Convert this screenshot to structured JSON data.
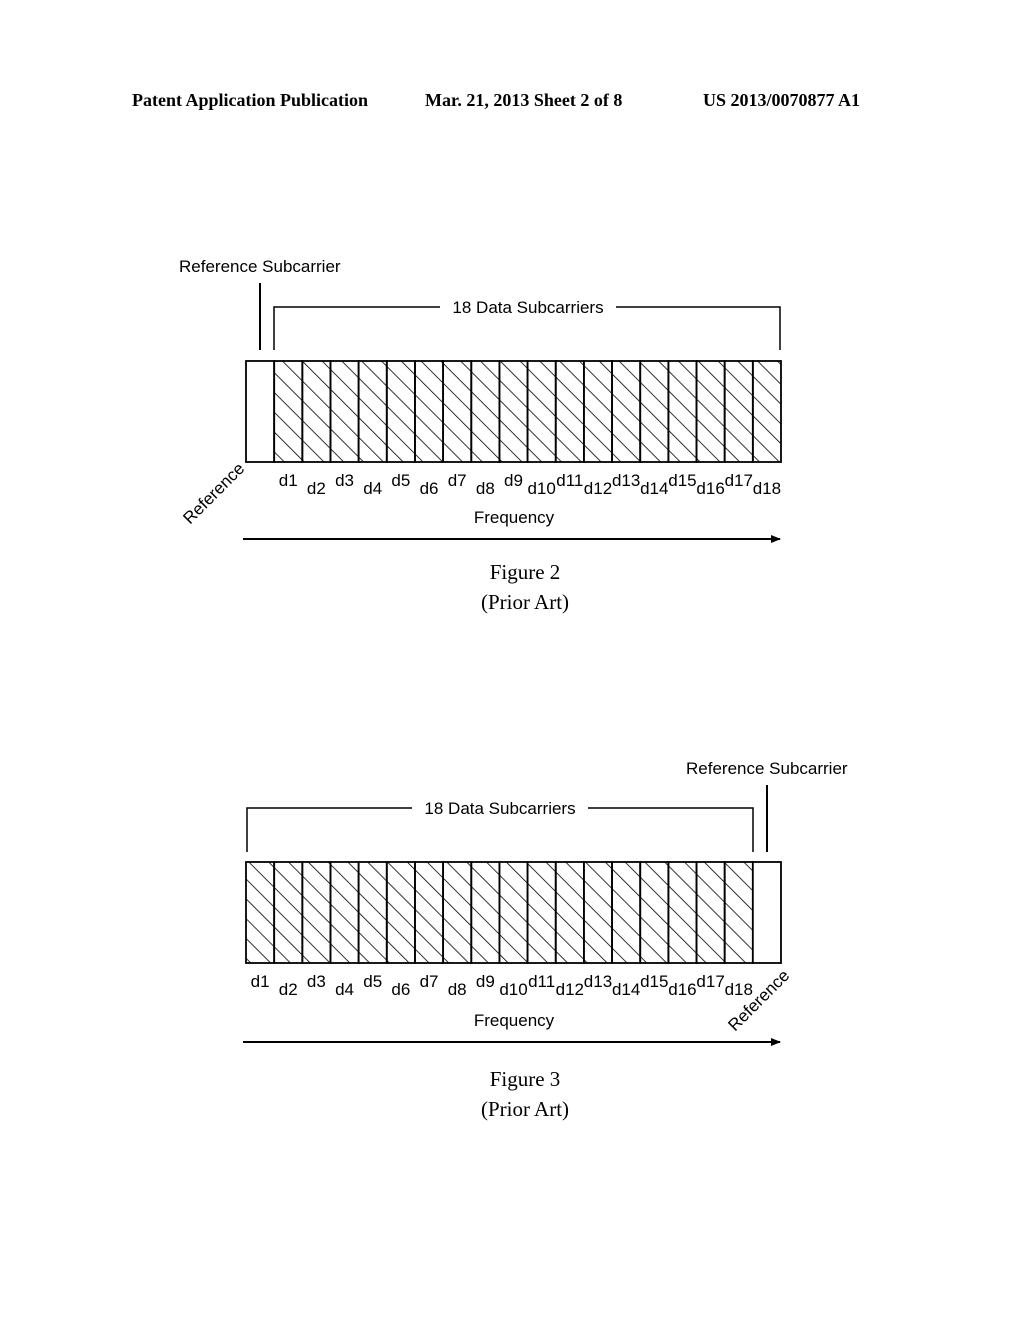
{
  "header": {
    "left": "Patent Application Publication",
    "center": "Mar. 21, 2013  Sheet 2 of 8",
    "right": "US 2013/0070877 A1"
  },
  "figure2": {
    "reference_subcarrier_label": "Reference Subcarrier",
    "data_bracket_label": "18 Data Subcarriers",
    "reference_label": "Reference",
    "reference_position": "left",
    "data_labels": [
      "d1",
      "d2",
      "d3",
      "d4",
      "d5",
      "d6",
      "d7",
      "d8",
      "d9",
      "d10",
      "d11",
      "d12",
      "d13",
      "d14",
      "d15",
      "d16",
      "d17",
      "d18"
    ],
    "axis_label": "Frequency",
    "caption": "Figure 2",
    "subcaption": "(Prior Art)"
  },
  "figure3": {
    "reference_subcarrier_label": "Reference Subcarrier",
    "data_bracket_label": "18 Data Subcarriers",
    "reference_label": "Reference",
    "reference_position": "right",
    "data_labels": [
      "d1",
      "d2",
      "d3",
      "d4",
      "d5",
      "d6",
      "d7",
      "d8",
      "d9",
      "d10",
      "d11",
      "d12",
      "d13",
      "d14",
      "d15",
      "d16",
      "d17",
      "d18"
    ],
    "axis_label": "Frequency",
    "caption": "Figure 3",
    "subcaption": "(Prior Art)"
  }
}
